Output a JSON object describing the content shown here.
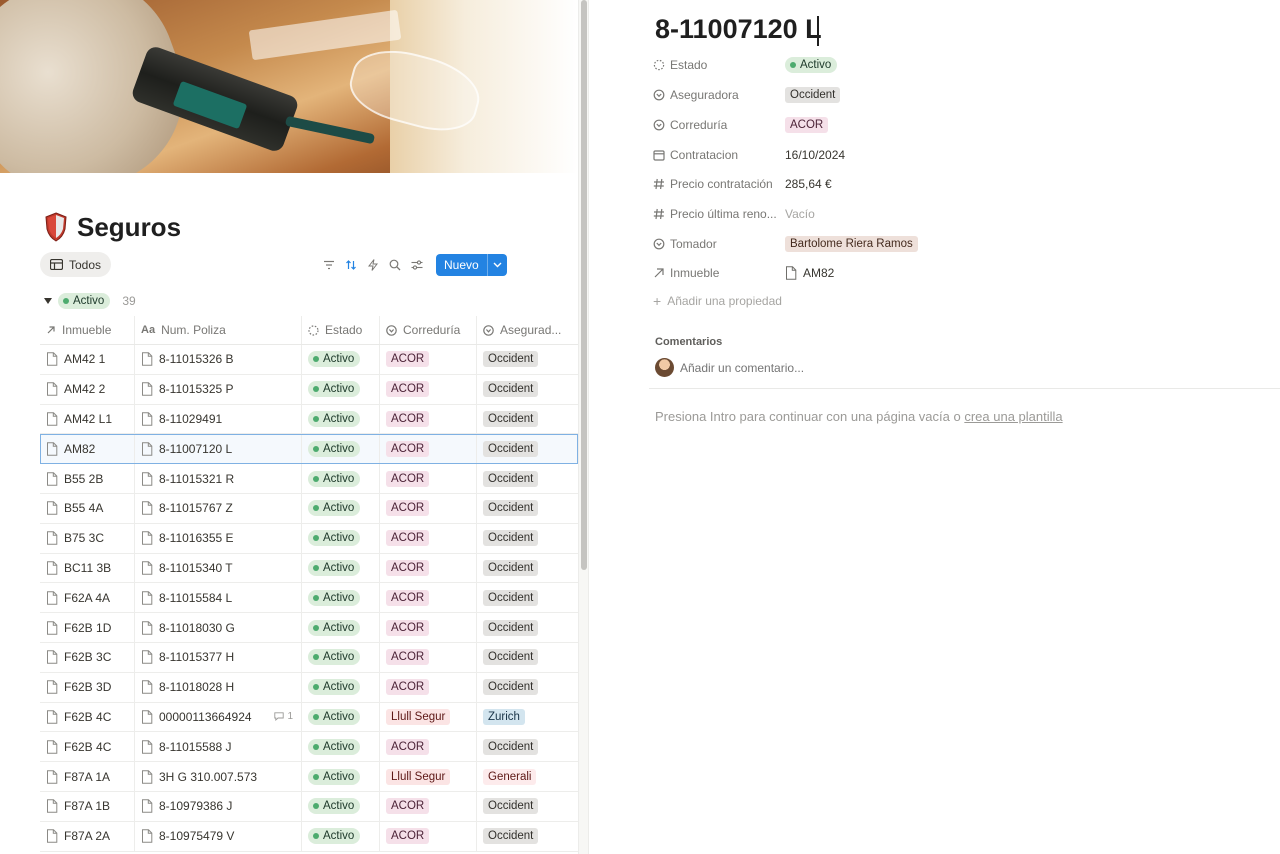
{
  "page": {
    "title": "Seguros",
    "view_tab": "Todos",
    "new_button": "Nuevo"
  },
  "group": {
    "label": "Activo",
    "count": "39"
  },
  "table": {
    "headers": [
      "Inmueble",
      "Num. Poliza",
      "Estado",
      "Correduría",
      "Asegurad..."
    ],
    "rows": [
      {
        "inmueble": "AM42 1",
        "poliza": "8-11015326 B",
        "estado": "Activo",
        "correduria": "ACOR",
        "aseguradora": "Occident"
      },
      {
        "inmueble": "AM42 2",
        "poliza": "8-11015325 P",
        "estado": "Activo",
        "correduria": "ACOR",
        "aseguradora": "Occident"
      },
      {
        "inmueble": "AM42 L1",
        "poliza": "8-11029491",
        "estado": "Activo",
        "correduria": "ACOR",
        "aseguradora": "Occident"
      },
      {
        "inmueble": "AM82",
        "poliza": "8-11007120 L",
        "estado": "Activo",
        "correduria": "ACOR",
        "aseguradora": "Occident",
        "selected": true
      },
      {
        "inmueble": "B55 2B",
        "poliza": "8-11015321 R",
        "estado": "Activo",
        "correduria": "ACOR",
        "aseguradora": "Occident"
      },
      {
        "inmueble": "B55 4A",
        "poliza": "8-11015767 Z",
        "estado": "Activo",
        "correduria": "ACOR",
        "aseguradora": "Occident"
      },
      {
        "inmueble": "B75 3C",
        "poliza": "8-11016355 E",
        "estado": "Activo",
        "correduria": "ACOR",
        "aseguradora": "Occident"
      },
      {
        "inmueble": "BC11 3B",
        "poliza": "8-11015340 T",
        "estado": "Activo",
        "correduria": "ACOR",
        "aseguradora": "Occident"
      },
      {
        "inmueble": "F62A 4A",
        "poliza": "8-11015584 L",
        "estado": "Activo",
        "correduria": "ACOR",
        "aseguradora": "Occident"
      },
      {
        "inmueble": "F62B 1D",
        "poliza": "8-11018030 G",
        "estado": "Activo",
        "correduria": "ACOR",
        "aseguradora": "Occident"
      },
      {
        "inmueble": "F62B 3C",
        "poliza": "8-11015377 H",
        "estado": "Activo",
        "correduria": "ACOR",
        "aseguradora": "Occident"
      },
      {
        "inmueble": "F62B 3D",
        "poliza": "8-11018028 H",
        "estado": "Activo",
        "correduria": "ACOR",
        "aseguradora": "Occident"
      },
      {
        "inmueble": "F62B 4C",
        "poliza": "00000113664924",
        "estado": "Activo",
        "correduria": "Llull Segur",
        "aseguradora": "Zurich",
        "comments": "1"
      },
      {
        "inmueble": "F62B 4C",
        "poliza": "8-11015588 J",
        "estado": "Activo",
        "correduria": "ACOR",
        "aseguradora": "Occident"
      },
      {
        "inmueble": "F87A 1A",
        "poliza": "3H G 310.007.573",
        "estado": "Activo",
        "correduria": "Llull Segur",
        "aseguradora": "Generali"
      },
      {
        "inmueble": "F87A 1B",
        "poliza": "8-10979386 J",
        "estado": "Activo",
        "correduria": "ACOR",
        "aseguradora": "Occident"
      },
      {
        "inmueble": "F87A 2A",
        "poliza": "8-10975479 V",
        "estado": "Activo",
        "correduria": "ACOR",
        "aseguradora": "Occident"
      }
    ]
  },
  "record": {
    "title": "8-11007120 L",
    "properties": [
      {
        "key": "estado",
        "label": "Estado",
        "value": "Activo",
        "icon": "status-icon"
      },
      {
        "key": "aseguradora",
        "label": "Aseguradora",
        "value": "Occident",
        "icon": "select-icon"
      },
      {
        "key": "correduria",
        "label": "Correduría",
        "value": "ACOR",
        "icon": "select-icon"
      },
      {
        "key": "contratacion",
        "label": "Contratacion",
        "value": "16/10/2024",
        "icon": "calendar-icon"
      },
      {
        "key": "precio_contratacion",
        "label": "Precio contratación",
        "value": "285,64 €",
        "icon": "number-icon"
      },
      {
        "key": "precio_ultima",
        "label": "Precio última reno...",
        "value": "Vacío",
        "icon": "number-icon"
      },
      {
        "key": "tomador",
        "label": "Tomador",
        "value": "Bartolome Riera Ramos",
        "icon": "select-icon"
      },
      {
        "key": "inmueble",
        "label": "Inmueble",
        "value": "AM82",
        "icon": "relation-icon"
      }
    ],
    "add_property": "Añadir una propiedad",
    "comments_label": "Comentarios",
    "comment_placeholder": "Añadir un comentario...",
    "empty_hint_prefix": "Presiona Intro para continuar con una página vacía o ",
    "empty_hint_link": "crea una plantilla"
  },
  "colors": {
    "accent": "#2383e2",
    "status_green": "#dbeddb",
    "acor_pink": "#f5e0e9",
    "occident_gray": "#e3e2e0"
  }
}
